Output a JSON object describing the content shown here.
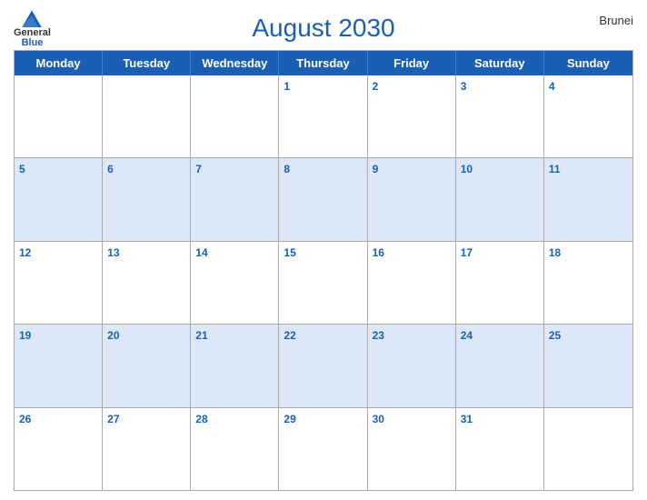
{
  "header": {
    "title": "August 2030",
    "country": "Brunei",
    "logo": {
      "general": "General",
      "blue": "Blue"
    }
  },
  "weekdays": [
    "Monday",
    "Tuesday",
    "Wednesday",
    "Thursday",
    "Friday",
    "Saturday",
    "Sunday"
  ],
  "weeks": [
    [
      {
        "day": "",
        "empty": true
      },
      {
        "day": "",
        "empty": true
      },
      {
        "day": "",
        "empty": true
      },
      {
        "day": "1",
        "empty": false
      },
      {
        "day": "2",
        "empty": false
      },
      {
        "day": "3",
        "empty": false
      },
      {
        "day": "4",
        "empty": false
      }
    ],
    [
      {
        "day": "5",
        "empty": false
      },
      {
        "day": "6",
        "empty": false
      },
      {
        "day": "7",
        "empty": false
      },
      {
        "day": "8",
        "empty": false
      },
      {
        "day": "9",
        "empty": false
      },
      {
        "day": "10",
        "empty": false
      },
      {
        "day": "11",
        "empty": false
      }
    ],
    [
      {
        "day": "12",
        "empty": false
      },
      {
        "day": "13",
        "empty": false
      },
      {
        "day": "14",
        "empty": false
      },
      {
        "day": "15",
        "empty": false
      },
      {
        "day": "16",
        "empty": false
      },
      {
        "day": "17",
        "empty": false
      },
      {
        "day": "18",
        "empty": false
      }
    ],
    [
      {
        "day": "19",
        "empty": false
      },
      {
        "day": "20",
        "empty": false
      },
      {
        "day": "21",
        "empty": false
      },
      {
        "day": "22",
        "empty": false
      },
      {
        "day": "23",
        "empty": false
      },
      {
        "day": "24",
        "empty": false
      },
      {
        "day": "25",
        "empty": false
      }
    ],
    [
      {
        "day": "26",
        "empty": false
      },
      {
        "day": "27",
        "empty": false
      },
      {
        "day": "28",
        "empty": false
      },
      {
        "day": "29",
        "empty": false
      },
      {
        "day": "30",
        "empty": false
      },
      {
        "day": "31",
        "empty": false
      },
      {
        "day": "",
        "empty": true
      }
    ]
  ],
  "colors": {
    "header_bg": "#1a5fb4",
    "alt_row_bg": "#dce8f8",
    "day_number_color": "#1a5fb4"
  }
}
